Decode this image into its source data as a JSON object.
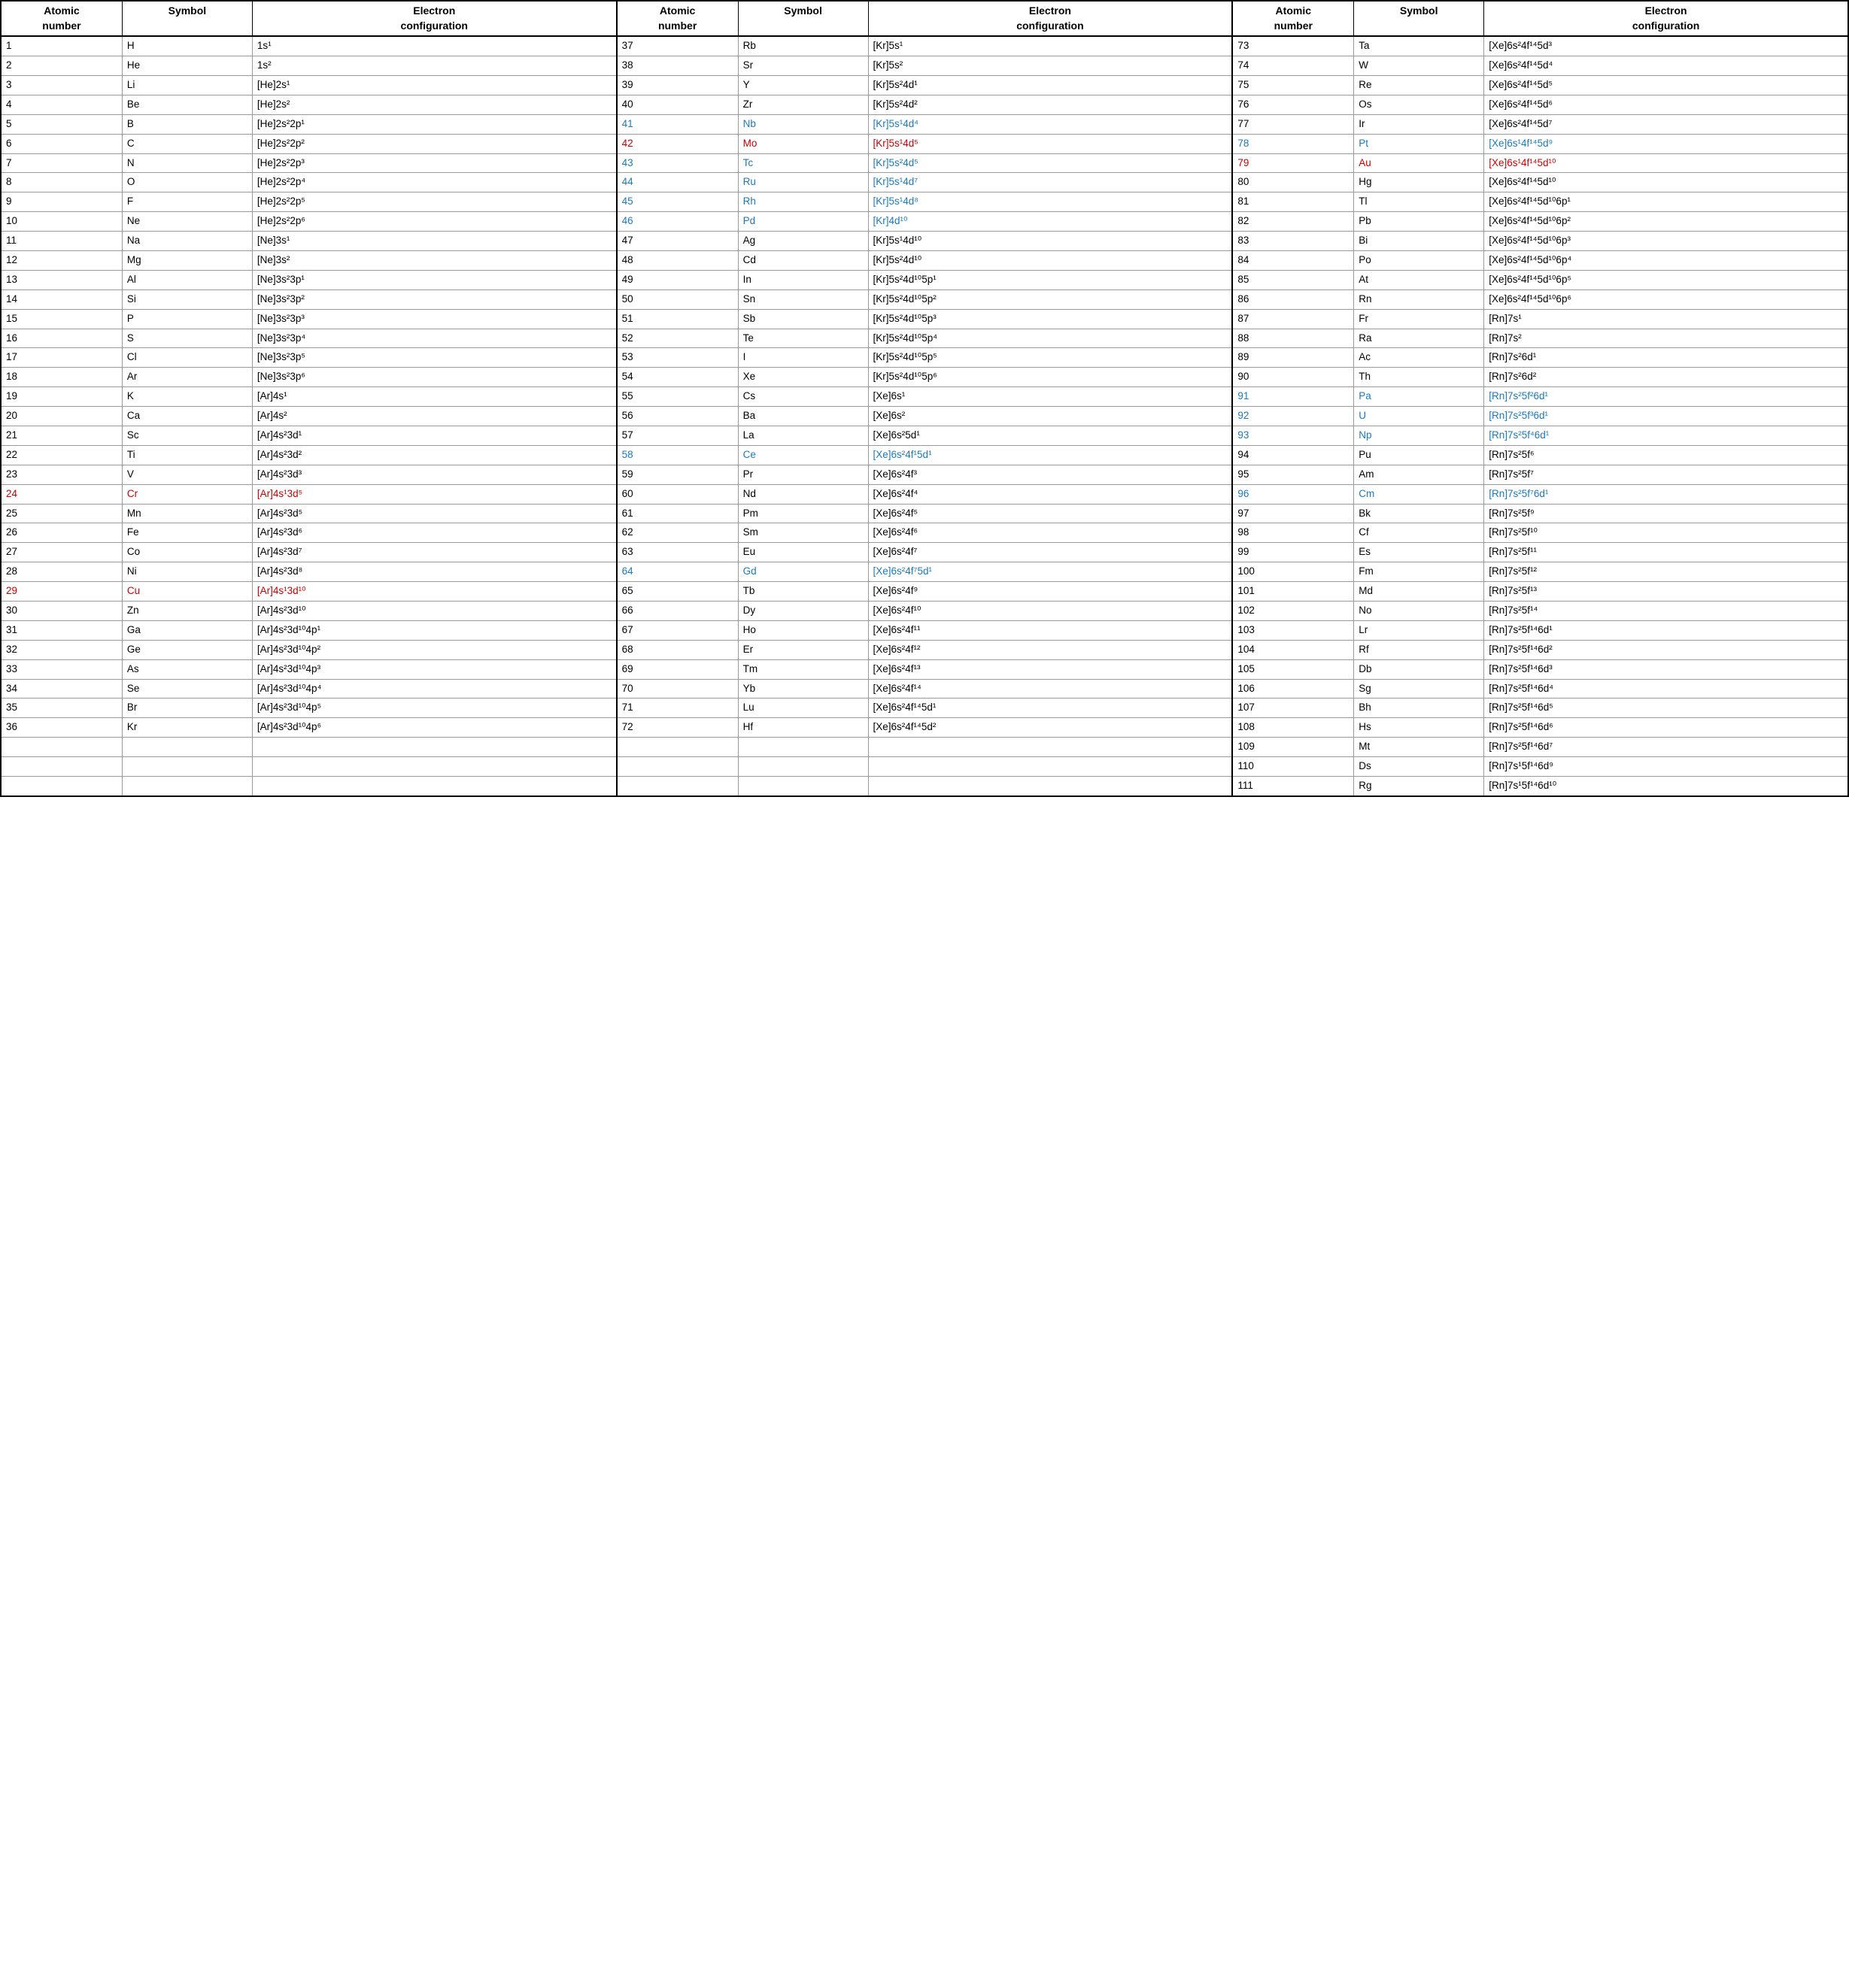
{
  "headers": [
    {
      "atomic": "Atomic number",
      "symbol": "Symbol",
      "electron": "Electron configuration"
    },
    {
      "atomic": "Atomic number",
      "symbol": "Symbol",
      "electron": "Electron configuration"
    },
    {
      "atomic": "Atomic number",
      "symbol": "Symbol",
      "electron": "Electron configuration"
    }
  ],
  "elements": [
    {
      "num": "1",
      "sym": "H",
      "conf": "1s¹",
      "style": "normal",
      "num2": "37",
      "sym2": "Rb",
      "conf2": "[Kr]5s¹",
      "style2": "normal",
      "num3": "73",
      "sym3": "Ta",
      "conf3": "[Xe]6s²4f¹⁴5d³",
      "style3": "normal"
    },
    {
      "num": "2",
      "sym": "He",
      "conf": "1s²",
      "style": "normal",
      "num2": "38",
      "sym2": "Sr",
      "conf2": "[Kr]5s²",
      "style2": "normal",
      "num3": "74",
      "sym3": "W",
      "conf3": "[Xe]6s²4f¹⁴5d⁴",
      "style3": "normal"
    },
    {
      "num": "3",
      "sym": "Li",
      "conf": "[He]2s¹",
      "style": "normal",
      "num2": "39",
      "sym2": "Y",
      "conf2": "[Kr]5s²4d¹",
      "style2": "normal",
      "num3": "75",
      "sym3": "Re",
      "conf3": "[Xe]6s²4f¹⁴5d⁵",
      "style3": "normal"
    },
    {
      "num": "4",
      "sym": "Be",
      "conf": "[He]2s²",
      "style": "normal",
      "num2": "40",
      "sym2": "Zr",
      "conf2": "[Kr]5s²4d²",
      "style2": "normal",
      "num3": "76",
      "sym3": "Os",
      "conf3": "[Xe]6s²4f¹⁴5d⁶",
      "style3": "normal"
    },
    {
      "num": "5",
      "sym": "B",
      "conf": "[He]2s²2p¹",
      "style": "normal",
      "num2": "41",
      "sym2": "Nb",
      "conf2": "[Kr]5s¹4d⁴",
      "style2": "blue",
      "num3": "77",
      "sym3": "Ir",
      "conf3": "[Xe]6s²4f¹⁴5d⁷",
      "style3": "normal"
    },
    {
      "num": "6",
      "sym": "C",
      "conf": "[He]2s²2p²",
      "style": "normal",
      "num2": "42",
      "sym2": "Mo",
      "conf2": "[Kr]5s¹4d⁵",
      "style2": "red",
      "num3": "78",
      "sym3": "Pt",
      "conf3": "[Xe]6s¹4f¹⁴5d⁹",
      "style3": "blue"
    },
    {
      "num": "7",
      "sym": "N",
      "conf": "[He]2s²2p³",
      "style": "normal",
      "num2": "43",
      "sym2": "Tc",
      "conf2": "[Kr]5s²4d⁵",
      "style2": "blue",
      "num3": "79",
      "sym3": "Au",
      "conf3": "[Xe]6s¹4f¹⁴5d¹⁰",
      "style3": "red"
    },
    {
      "num": "8",
      "sym": "O",
      "conf": "[He]2s²2p⁴",
      "style": "normal",
      "num2": "44",
      "sym2": "Ru",
      "conf2": "[Kr]5s¹4d⁷",
      "style2": "blue",
      "num3": "80",
      "sym3": "Hg",
      "conf3": "[Xe]6s²4f¹⁴5d¹⁰",
      "style3": "normal"
    },
    {
      "num": "9",
      "sym": "F",
      "conf": "[He]2s²2p⁵",
      "style": "normal",
      "num2": "45",
      "sym2": "Rh",
      "conf2": "[Kr]5s¹4d⁸",
      "style2": "blue",
      "num3": "81",
      "sym3": "Tl",
      "conf3": "[Xe]6s²4f¹⁴5d¹⁰6p¹",
      "style3": "normal"
    },
    {
      "num": "10",
      "sym": "Ne",
      "conf": "[He]2s²2p⁶",
      "style": "normal",
      "num2": "46",
      "sym2": "Pd",
      "conf2": "[Kr]4d¹⁰",
      "style2": "blue",
      "num3": "82",
      "sym3": "Pb",
      "conf3": "[Xe]6s²4f¹⁴5d¹⁰6p²",
      "style3": "normal"
    },
    {
      "num": "11",
      "sym": "Na",
      "conf": "[Ne]3s¹",
      "style": "normal",
      "num2": "47",
      "sym2": "Ag",
      "conf2": "[Kr]5s¹4d¹⁰",
      "style2": "normal",
      "num3": "83",
      "sym3": "Bi",
      "conf3": "[Xe]6s²4f¹⁴5d¹⁰6p³",
      "style3": "normal"
    },
    {
      "num": "12",
      "sym": "Mg",
      "conf": "[Ne]3s²",
      "style": "normal",
      "num2": "48",
      "sym2": "Cd",
      "conf2": "[Kr]5s²4d¹⁰",
      "style2": "normal",
      "num3": "84",
      "sym3": "Po",
      "conf3": "[Xe]6s²4f¹⁴5d¹⁰6p⁴",
      "style3": "normal"
    },
    {
      "num": "13",
      "sym": "Al",
      "conf": "[Ne]3s²3p¹",
      "style": "normal",
      "num2": "49",
      "sym2": "In",
      "conf2": "[Kr]5s²4d¹⁰5p¹",
      "style2": "normal",
      "num3": "85",
      "sym3": "At",
      "conf3": "[Xe]6s²4f¹⁴5d¹⁰6p⁵",
      "style3": "normal"
    },
    {
      "num": "14",
      "sym": "Si",
      "conf": "[Ne]3s²3p²",
      "style": "normal",
      "num2": "50",
      "sym2": "Sn",
      "conf2": "[Kr]5s²4d¹⁰5p²",
      "style2": "normal",
      "num3": "86",
      "sym3": "Rn",
      "conf3": "[Xe]6s²4f¹⁴5d¹⁰6p⁶",
      "style3": "normal"
    },
    {
      "num": "15",
      "sym": "P",
      "conf": "[Ne]3s²3p³",
      "style": "normal",
      "num2": "51",
      "sym2": "Sb",
      "conf2": "[Kr]5s²4d¹⁰5p³",
      "style2": "normal",
      "num3": "87",
      "sym3": "Fr",
      "conf3": "[Rn]7s¹",
      "style3": "normal"
    },
    {
      "num": "16",
      "sym": "S",
      "conf": "[Ne]3s²3p⁴",
      "style": "normal",
      "num2": "52",
      "sym2": "Te",
      "conf2": "[Kr]5s²4d¹⁰5p⁴",
      "style2": "normal",
      "num3": "88",
      "sym3": "Ra",
      "conf3": "[Rn]7s²",
      "style3": "normal"
    },
    {
      "num": "17",
      "sym": "Cl",
      "conf": "[Ne]3s²3p⁵",
      "style": "normal",
      "num2": "53",
      "sym2": "I",
      "conf2": "[Kr]5s²4d¹⁰5p⁵",
      "style2": "normal",
      "num3": "89",
      "sym3": "Ac",
      "conf3": "[Rn]7s²6d¹",
      "style3": "normal"
    },
    {
      "num": "18",
      "sym": "Ar",
      "conf": "[Ne]3s²3p⁶",
      "style": "normal",
      "num2": "54",
      "sym2": "Xe",
      "conf2": "[Kr]5s²4d¹⁰5p⁶",
      "style2": "normal",
      "num3": "90",
      "sym3": "Th",
      "conf3": "[Rn]7s²6d²",
      "style3": "normal"
    },
    {
      "num": "19",
      "sym": "K",
      "conf": "[Ar]4s¹",
      "style": "normal",
      "num2": "55",
      "sym2": "Cs",
      "conf2": "[Xe]6s¹",
      "style2": "normal",
      "num3": "91",
      "sym3": "Pa",
      "conf3": "[Rn]7s²5f²6d¹",
      "style3": "blue"
    },
    {
      "num": "20",
      "sym": "Ca",
      "conf": "[Ar]4s²",
      "style": "normal",
      "num2": "56",
      "sym2": "Ba",
      "conf2": "[Xe]6s²",
      "style2": "normal",
      "num3": "92",
      "sym3": "U",
      "conf3": "[Rn]7s²5f³6d¹",
      "style3": "blue"
    },
    {
      "num": "21",
      "sym": "Sc",
      "conf": "[Ar]4s²3d¹",
      "style": "normal",
      "num2": "57",
      "sym2": "La",
      "conf2": "[Xe]6s²5d¹",
      "style2": "normal",
      "num3": "93",
      "sym3": "Np",
      "conf3": "[Rn]7s²5f⁴6d¹",
      "style3": "blue"
    },
    {
      "num": "22",
      "sym": "Ti",
      "conf": "[Ar]4s²3d²",
      "style": "normal",
      "num2": "58",
      "sym2": "Ce",
      "conf2": "[Xe]6s²4f¹5d¹",
      "style2": "blue",
      "num3": "94",
      "sym3": "Pu",
      "conf3": "[Rn]7s²5f⁶",
      "style3": "normal"
    },
    {
      "num": "23",
      "sym": "V",
      "conf": "[Ar]4s²3d³",
      "style": "normal",
      "num2": "59",
      "sym2": "Pr",
      "conf2": "[Xe]6s²4f³",
      "style2": "normal",
      "num3": "95",
      "sym3": "Am",
      "conf3": "[Rn]7s²5f⁷",
      "style3": "normal"
    },
    {
      "num": "24",
      "sym": "Cr",
      "conf": "[Ar]4s¹3d⁵",
      "style": "red",
      "num2": "60",
      "sym2": "Nd",
      "conf2": "[Xe]6s²4f⁴",
      "style2": "normal",
      "num3": "96",
      "sym3": "Cm",
      "conf3": "[Rn]7s²5f⁷6d¹",
      "style3": "blue"
    },
    {
      "num": "25",
      "sym": "Mn",
      "conf": "[Ar]4s²3d⁵",
      "style": "normal",
      "num2": "61",
      "sym2": "Pm",
      "conf2": "[Xe]6s²4f⁵",
      "style2": "normal",
      "num3": "97",
      "sym3": "Bk",
      "conf3": "[Rn]7s²5f⁹",
      "style3": "normal"
    },
    {
      "num": "26",
      "sym": "Fe",
      "conf": "[Ar]4s²3d⁶",
      "style": "normal",
      "num2": "62",
      "sym2": "Sm",
      "conf2": "[Xe]6s²4f⁶",
      "style2": "normal",
      "num3": "98",
      "sym3": "Cf",
      "conf3": "[Rn]7s²5f¹⁰",
      "style3": "normal"
    },
    {
      "num": "27",
      "sym": "Co",
      "conf": "[Ar]4s²3d⁷",
      "style": "normal",
      "num2": "63",
      "sym2": "Eu",
      "conf2": "[Xe]6s²4f⁷",
      "style2": "normal",
      "num3": "99",
      "sym3": "Es",
      "conf3": "[Rn]7s²5f¹¹",
      "style3": "normal"
    },
    {
      "num": "28",
      "sym": "Ni",
      "conf": "[Ar]4s²3d⁸",
      "style": "normal",
      "num2": "64",
      "sym2": "Gd",
      "conf2": "[Xe]6s²4f⁷5d¹",
      "style2": "blue",
      "num3": "100",
      "sym3": "Fm",
      "conf3": "[Rn]7s²5f¹²",
      "style3": "normal"
    },
    {
      "num": "29",
      "sym": "Cu",
      "conf": "[Ar]4s¹3d¹⁰",
      "style": "red",
      "num2": "65",
      "sym2": "Tb",
      "conf2": "[Xe]6s²4f⁹",
      "style2": "normal",
      "num3": "101",
      "sym3": "Md",
      "conf3": "[Rn]7s²5f¹³",
      "style3": "normal"
    },
    {
      "num": "30",
      "sym": "Zn",
      "conf": "[Ar]4s²3d¹⁰",
      "style": "normal",
      "num2": "66",
      "sym2": "Dy",
      "conf2": "[Xe]6s²4f¹⁰",
      "style2": "normal",
      "num3": "102",
      "sym3": "No",
      "conf3": "[Rn]7s²5f¹⁴",
      "style3": "normal"
    },
    {
      "num": "31",
      "sym": "Ga",
      "conf": "[Ar]4s²3d¹⁰4p¹",
      "style": "normal",
      "num2": "67",
      "sym2": "Ho",
      "conf2": "[Xe]6s²4f¹¹",
      "style2": "normal",
      "num3": "103",
      "sym3": "Lr",
      "conf3": "[Rn]7s²5f¹⁴6d¹",
      "style3": "normal"
    },
    {
      "num": "32",
      "sym": "Ge",
      "conf": "[Ar]4s²3d¹⁰4p²",
      "style": "normal",
      "num2": "68",
      "sym2": "Er",
      "conf2": "[Xe]6s²4f¹²",
      "style2": "normal",
      "num3": "104",
      "sym3": "Rf",
      "conf3": "[Rn]7s²5f¹⁴6d²",
      "style3": "normal"
    },
    {
      "num": "33",
      "sym": "As",
      "conf": "[Ar]4s²3d¹⁰4p³",
      "style": "normal",
      "num2": "69",
      "sym2": "Tm",
      "conf2": "[Xe]6s²4f¹³",
      "style2": "normal",
      "num3": "105",
      "sym3": "Db",
      "conf3": "[Rn]7s²5f¹⁴6d³",
      "style3": "normal"
    },
    {
      "num": "34",
      "sym": "Se",
      "conf": "[Ar]4s²3d¹⁰4p⁴",
      "style": "normal",
      "num2": "70",
      "sym2": "Yb",
      "conf2": "[Xe]6s²4f¹⁴",
      "style2": "normal",
      "num3": "106",
      "sym3": "Sg",
      "conf3": "[Rn]7s²5f¹⁴6d⁴",
      "style3": "normal"
    },
    {
      "num": "35",
      "sym": "Br",
      "conf": "[Ar]4s²3d¹⁰4p⁵",
      "style": "normal",
      "num2": "71",
      "sym2": "Lu",
      "conf2": "[Xe]6s²4f¹⁴5d¹",
      "style2": "normal",
      "num3": "107",
      "sym3": "Bh",
      "conf3": "[Rn]7s²5f¹⁴6d⁵",
      "style3": "normal"
    },
    {
      "num": "36",
      "sym": "Kr",
      "conf": "[Ar]4s²3d¹⁰4p⁶",
      "style": "normal",
      "num2": "72",
      "sym2": "Hf",
      "conf2": "[Xe]6s²4f¹⁴5d²",
      "style2": "normal",
      "num3": "108",
      "sym3": "Hs",
      "conf3": "[Rn]7s²5f¹⁴6d⁶",
      "style3": "normal"
    },
    {
      "num": "",
      "sym": "",
      "conf": "",
      "style": "normal",
      "num2": "",
      "sym2": "",
      "conf2": "",
      "style2": "normal",
      "num3": "109",
      "sym3": "Mt",
      "conf3": "[Rn]7s²5f¹⁴6d⁷",
      "style3": "normal"
    },
    {
      "num": "",
      "sym": "",
      "conf": "",
      "style": "normal",
      "num2": "",
      "sym2": "",
      "conf2": "",
      "style2": "normal",
      "num3": "110",
      "sym3": "Ds",
      "conf3": "[Rn]7s¹5f¹⁴6d⁹",
      "style3": "normal"
    },
    {
      "num": "",
      "sym": "",
      "conf": "",
      "style": "normal",
      "num2": "",
      "sym2": "",
      "conf2": "",
      "style2": "normal",
      "num3": "111",
      "sym3": "Rg",
      "conf3": "[Rn]7s¹5f¹⁴6d¹⁰",
      "style3": "normal"
    }
  ]
}
